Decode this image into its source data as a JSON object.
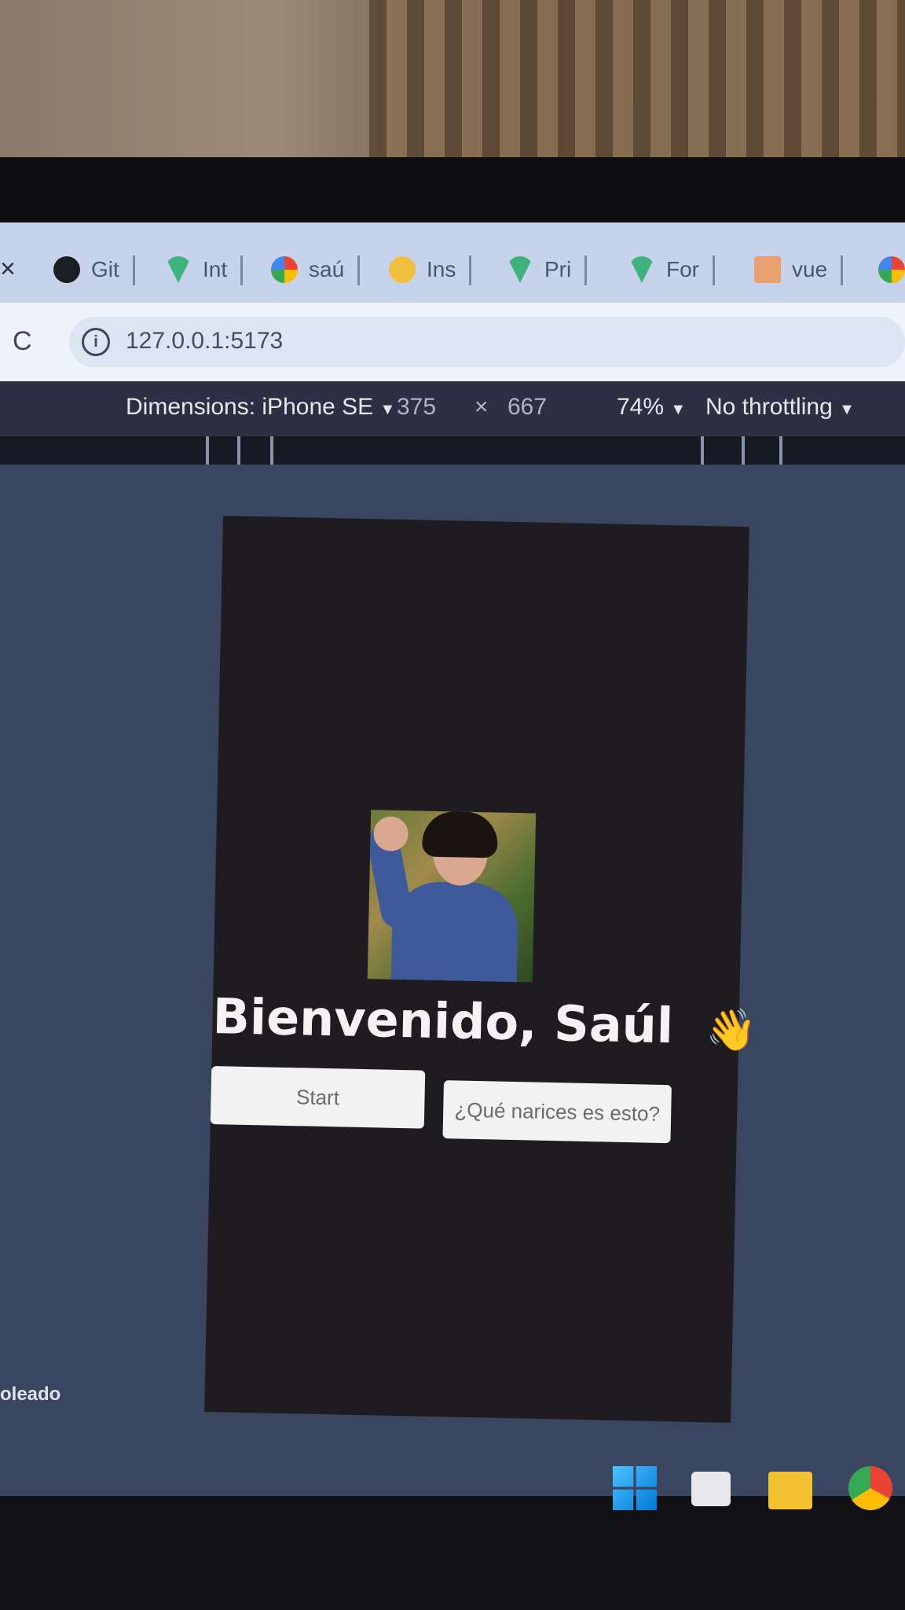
{
  "browser": {
    "tabs": [
      {
        "label": "Git",
        "icon": "github-icon"
      },
      {
        "label": "Int",
        "icon": "vue-icon"
      },
      {
        "label": "saú",
        "icon": "google-icon"
      },
      {
        "label": "Ins",
        "icon": "flower-icon"
      },
      {
        "label": "Pri",
        "icon": "vue-icon"
      },
      {
        "label": "For",
        "icon": "vue-icon"
      },
      {
        "label": "vue",
        "icon": "stack-icon"
      },
      {
        "label": "",
        "icon": "google-icon"
      }
    ],
    "close_tab": "×",
    "reload": "C",
    "url": "127.0.0.1:5173",
    "info_icon": "i"
  },
  "devtools": {
    "dimensions_label": "Dimensions: iPhone SE",
    "width": "375",
    "times": "×",
    "height": "667",
    "zoom": "74%",
    "throttling": "No throttling",
    "dropdown_glyph": "▼"
  },
  "app": {
    "title": "Bienvenido, Saúl",
    "wave_emoji": "👋",
    "start_button": "Start",
    "about_button": "¿Qué narices es esto?"
  },
  "desktop": {
    "side_label": "oleado"
  },
  "colors": {
    "app_background": "#1e1c20",
    "button_background": "#f2f2f2",
    "devtools_background": "#2b3143",
    "tabstrip": "#c6d3ea"
  }
}
